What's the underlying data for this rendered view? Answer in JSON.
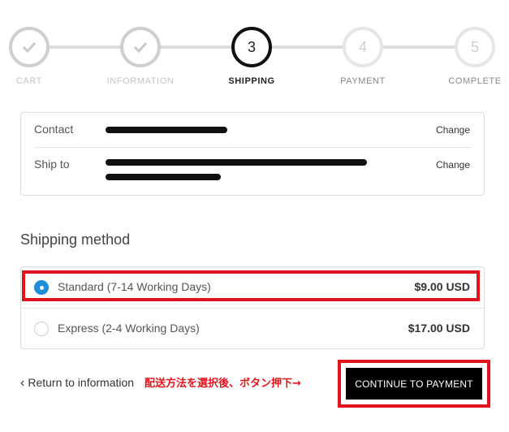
{
  "stepper": {
    "steps": [
      {
        "label": "CART",
        "state": "done",
        "icon": "check-icon"
      },
      {
        "label": "INFORMATION",
        "state": "done",
        "icon": "check-icon"
      },
      {
        "label": "SHIPPING",
        "state": "active",
        "number": "3"
      },
      {
        "label": "PAYMENT",
        "state": "todo",
        "number": "4"
      },
      {
        "label": "COMPLETE",
        "state": "todo",
        "number": "5"
      }
    ]
  },
  "info": {
    "contact_label": "Contact",
    "ship_to_label": "Ship to",
    "change_label": "Change"
  },
  "shipping": {
    "title": "Shipping method",
    "options": [
      {
        "label": "Standard (7-14 Working Days)",
        "price": "$9.00 USD",
        "selected": true
      },
      {
        "label": "Express (2-4 Working Days)",
        "price": "$17.00 USD",
        "selected": false
      }
    ]
  },
  "footer": {
    "return_label": "Return to information",
    "annotation": "配送方法を選択後、ボタン押下→",
    "continue_label": "CONTINUE TO PAYMENT"
  },
  "colors": {
    "accent_red": "#e0141e",
    "radio_blue": "#1e8fd6",
    "button_bg": "#000000"
  }
}
